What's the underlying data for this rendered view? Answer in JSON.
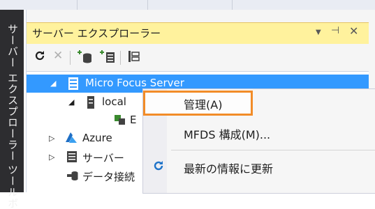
{
  "sidebar": {
    "tabs": [
      {
        "label": "サーバー エクスプローラー"
      },
      {
        "label": "ツールボ"
      }
    ]
  },
  "panel": {
    "title": "サーバー エクスプローラー",
    "buttons": {
      "dropdown": "▼",
      "pin": "⊣",
      "close": "✕"
    }
  },
  "toolbar": {
    "refresh_icon": "refresh-icon",
    "stop_icon": "stop-icon",
    "connect_db_icon": "connect-database-icon",
    "connect_server_icon": "connect-server-icon",
    "sharepoint_icon": "connect-sharepoint-icon"
  },
  "tree": {
    "items": [
      {
        "label": "Micro Focus Server",
        "arrow": "◢",
        "selected": true
      },
      {
        "label": "local",
        "arrow": "◢"
      },
      {
        "label": "E"
      },
      {
        "label": "Azure",
        "arrow": "▷"
      },
      {
        "label": "サーバー",
        "arrow": "▷"
      },
      {
        "label": "データ接続"
      }
    ]
  },
  "context_menu": {
    "items": [
      {
        "label": "管理(A)"
      },
      {
        "label": "MFDS 構成(M)..."
      },
      {
        "label": "最新の情報に更新"
      }
    ]
  },
  "colors": {
    "accent": "#3399ff",
    "title_bar": "#fff29d",
    "highlight_border": "#f28c28",
    "dock": "#2d2d30"
  }
}
